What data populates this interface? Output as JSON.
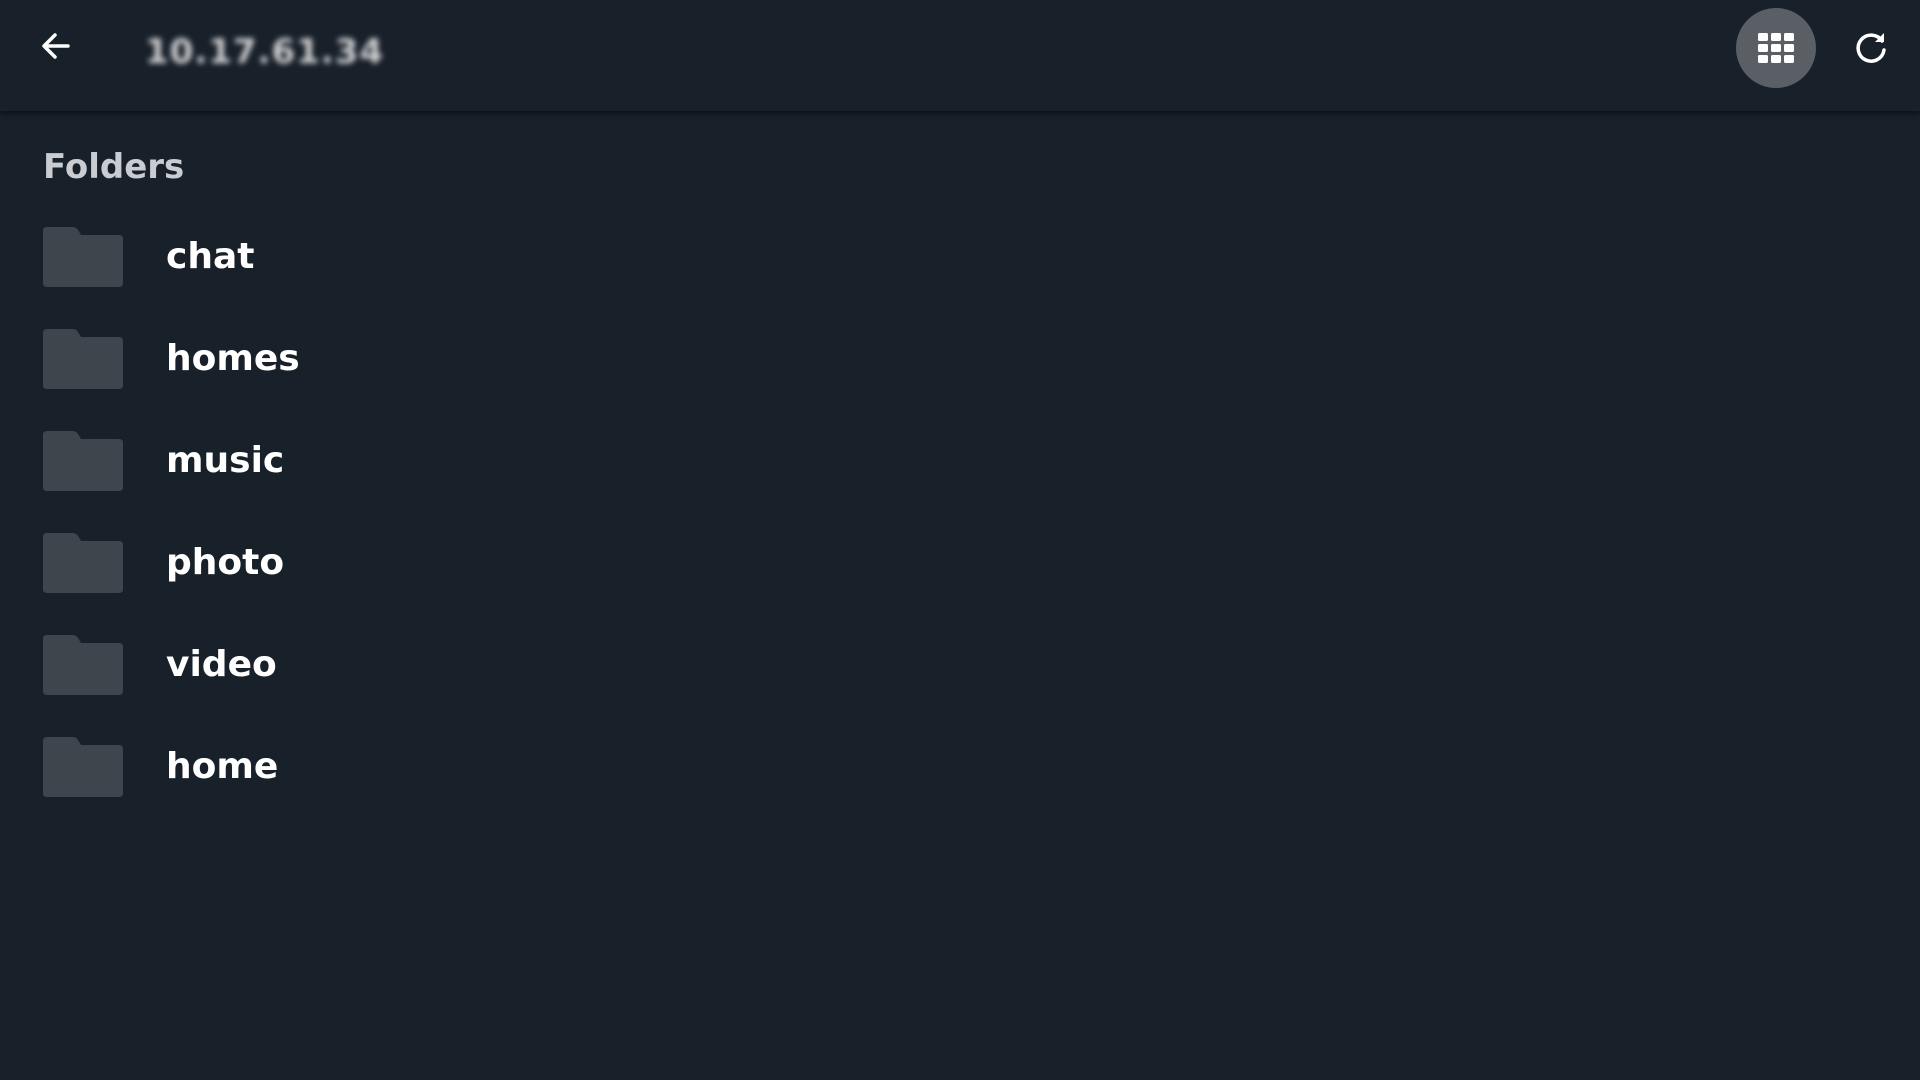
{
  "header": {
    "title": "10.17.61.34",
    "back_icon": "arrow-left-icon",
    "grid_icon": "grid-view-icon",
    "refresh_icon": "refresh-icon"
  },
  "main": {
    "section_heading": "Folders",
    "folders": [
      {
        "name": "chat",
        "icon": "folder-icon"
      },
      {
        "name": "homes",
        "icon": "folder-icon"
      },
      {
        "name": "music",
        "icon": "folder-icon"
      },
      {
        "name": "photo",
        "icon": "folder-icon"
      },
      {
        "name": "video",
        "icon": "folder-icon"
      },
      {
        "name": "home",
        "icon": "folder-icon"
      }
    ]
  },
  "colors": {
    "background": "#18202a",
    "folder": "#3f454d",
    "grid_button_bg": "#5a5f66",
    "text": "#ffffff",
    "heading": "#c9ccd1"
  }
}
